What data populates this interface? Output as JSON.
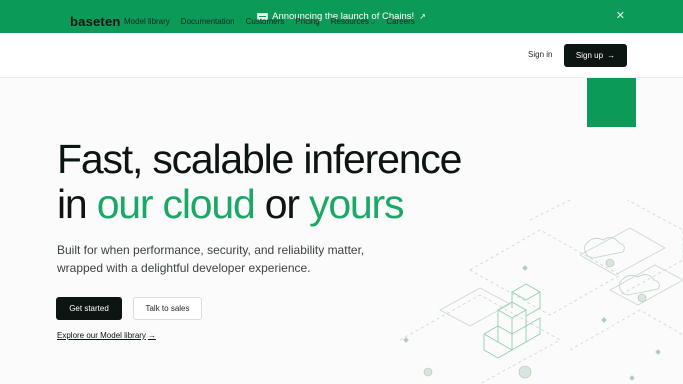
{
  "announcement": {
    "text": "Announcing the launch of Chains!",
    "arrow_icon": "arrow-up-right-icon",
    "close_icon": "close-icon"
  },
  "nav": {
    "brand": "baseten",
    "items": [
      {
        "label": "Model library"
      },
      {
        "label": "Documentation"
      },
      {
        "label": "Customers"
      },
      {
        "label": "Pricing"
      },
      {
        "label": "Resources",
        "dropdown": true
      },
      {
        "label": "Careers"
      }
    ],
    "signin": "Sign in",
    "signup": "Sign up",
    "signup_arrow": "→"
  },
  "hero": {
    "line1": "Fast, scalable inference",
    "line2_prefix": "in ",
    "line2_accent1": "our cloud",
    "line2_mid": " or ",
    "line2_accent2": "yours",
    "subtitle": "Built for when performance, security, and reliability matter, wrapped with a delightful developer experience.",
    "primary_button": "Get started",
    "secondary_button": "Talk to sales",
    "explore_link": "Explore our Model library",
    "explore_arrow": "→"
  },
  "colors": {
    "brand_green": "#0b9a58",
    "accent_text": "#1aa867",
    "dark": "#0c1512"
  }
}
